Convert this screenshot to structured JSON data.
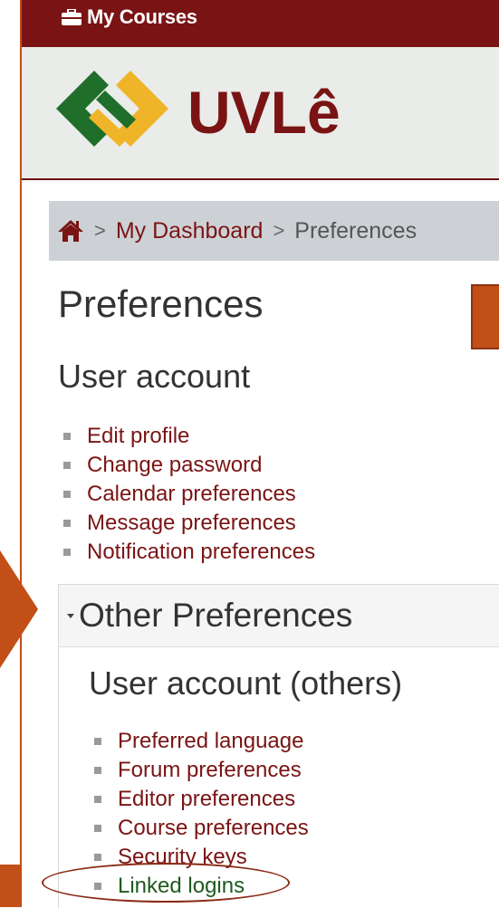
{
  "topbar": {
    "my_courses_label": "My Courses"
  },
  "brand": {
    "name": "UVLê"
  },
  "breadcrumb": {
    "separator": ">",
    "items": [
      {
        "label": "My Dashboard"
      },
      {
        "label": "Preferences"
      }
    ]
  },
  "page": {
    "title": "Preferences"
  },
  "user_account": {
    "heading": "User account",
    "links": [
      {
        "label": "Edit profile"
      },
      {
        "label": "Change password"
      },
      {
        "label": "Calendar preferences"
      },
      {
        "label": "Message preferences"
      },
      {
        "label": "Notification preferences"
      }
    ]
  },
  "other_preferences": {
    "title": "Other Preferences",
    "heading": "User account (others)",
    "links": [
      {
        "label": "Preferred language"
      },
      {
        "label": "Forum preferences"
      },
      {
        "label": "Editor preferences"
      },
      {
        "label": "Course preferences"
      },
      {
        "label": "Security keys"
      },
      {
        "label": "Linked logins"
      }
    ]
  },
  "colors": {
    "brand_dark_red": "#7a1414",
    "accent_orange": "#c24f17",
    "logo_green": "#1f6e2a",
    "logo_yellow": "#f0b429"
  }
}
